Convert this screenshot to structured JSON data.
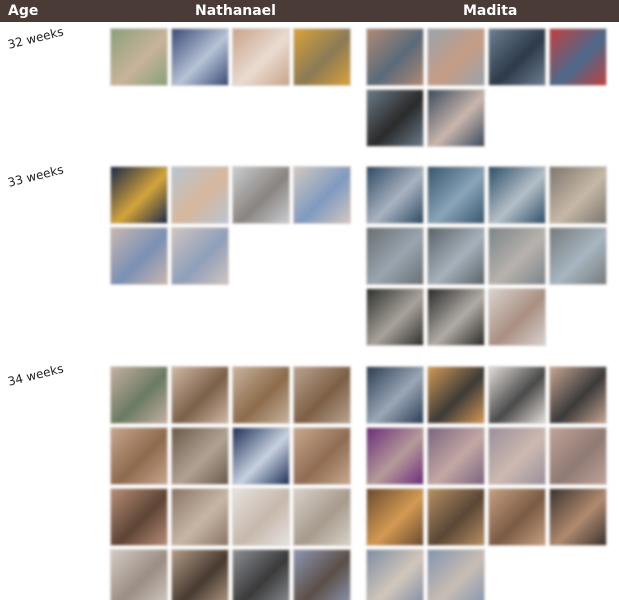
{
  "header": {
    "age_label": "Age",
    "col1_label": "Nathanael",
    "col2_label": "Madita",
    "background": "#4a3b37"
  },
  "rows": [
    {
      "age": "32 weeks",
      "nathanael_photos": [
        [
          "#8aa07a",
          "#c9b39a"
        ],
        [
          "#3a4c78",
          "#b7c3d6"
        ],
        [
          "#c8a48a",
          "#eadbd0"
        ],
        [
          "#d9a23a",
          "#8b7a55"
        ]
      ],
      "madita_photos": [
        [
          "#b08a74",
          "#5a6a7a"
        ],
        [
          "#9aa3ad",
          "#c79c84"
        ],
        [
          "#6d7f92",
          "#2d3a4a"
        ],
        [
          "#c0403f",
          "#4c6a8c"
        ],
        [
          "#6b7b88",
          "#2a2a2a"
        ],
        [
          "#3c4b5e",
          "#c9b6ad"
        ]
      ]
    },
    {
      "age": "33 weeks",
      "nathanael_photos": [
        [
          "#1d2a4a",
          "#d3a43a"
        ],
        [
          "#b9c5d3",
          "#d7b79c"
        ],
        [
          "#c9cdd1",
          "#8a8480"
        ],
        [
          "#d2c8bf",
          "#7f9ac0"
        ],
        [
          "#c9b7b0",
          "#7a90b5"
        ],
        [
          "#d0c4c0",
          "#8f9fba"
        ]
      ],
      "madita_photos": [
        [
          "#2f4a63",
          "#a9b3c1"
        ],
        [
          "#38576f",
          "#8aa4b8"
        ],
        [
          "#2e4f68",
          "#b5c0c8"
        ],
        [
          "#7c776f",
          "#c6b8a6"
        ],
        [
          "#6a6f72",
          "#9aa5b0"
        ],
        [
          "#5b6367",
          "#a6b1bb"
        ],
        [
          "#7c8589",
          "#b7b2ad"
        ],
        [
          "#777b7c",
          "#a7b6c1"
        ],
        [
          "#2f302e",
          "#a8a39b"
        ],
        [
          "#2b2b2a",
          "#b1aca5"
        ],
        [
          "#d9d3ce",
          "#a98f82"
        ]
      ]
    },
    {
      "age": "34 weeks",
      "nathanael_photos": [
        [
          "#c5b0a3",
          "#6a7a62"
        ],
        [
          "#d0b8a6",
          "#7a6048"
        ],
        [
          "#c8b39e",
          "#8c6b4a"
        ],
        [
          "#b9a492",
          "#7d5f44"
        ],
        [
          "#c7a58e",
          "#8e6a4d"
        ],
        [
          "#6b5a4a",
          "#b1a394"
        ],
        [
          "#1f3158",
          "#c8d1e0"
        ],
        [
          "#c8a88f",
          "#8f6c52"
        ],
        [
          "#b78e78",
          "#5d4434"
        ],
        [
          "#8a7565",
          "#c7b6a6"
        ],
        [
          "#e6e2de",
          "#c6b8ab"
        ],
        [
          "#d8d1c8",
          "#a79a8d"
        ],
        [
          "#d3cbc5",
          "#9a8d83"
        ],
        [
          "#b39c86",
          "#473a30"
        ],
        [
          "#8d8f96",
          "#3a3a3a"
        ],
        [
          "#8e96b2",
          "#5b4f47"
        ]
      ],
      "madita_photos": [
        [
          "#2c3d55",
          "#9aa7b6"
        ],
        [
          "#d29a55",
          "#3e3a38"
        ],
        [
          "#e2dcd8",
          "#4a4a4a"
        ],
        [
          "#c7a591",
          "#3a3a3a"
        ],
        [
          "#6c2e7a",
          "#b69b9a"
        ],
        [
          "#7a6480",
          "#c3a8a4"
        ],
        [
          "#9a8f9c",
          "#cdb9b0"
        ],
        [
          "#c0a398",
          "#8f7a74"
        ],
        [
          "#6a4a30",
          "#d39a52"
        ],
        [
          "#b89062",
          "#5a4636"
        ],
        [
          "#c6a080",
          "#7a5a44"
        ],
        [
          "#3a3330",
          "#b08a6e"
        ],
        [
          "#7f8da4",
          "#d1c6bb"
        ],
        [
          "#8395b0",
          "#c8bdb3"
        ]
      ]
    }
  ]
}
